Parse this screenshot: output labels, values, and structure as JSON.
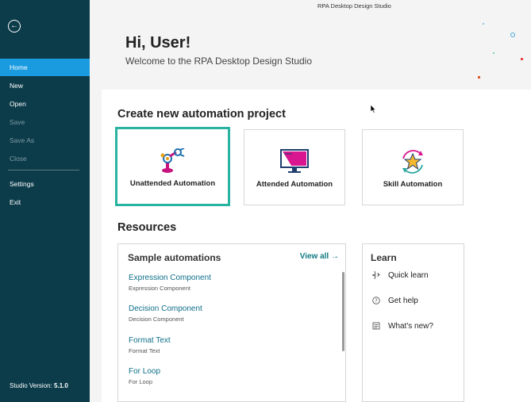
{
  "window": {
    "title": "RPA Desktop Design Studio"
  },
  "sidebar": {
    "items": [
      {
        "label": "Home",
        "state": "active"
      },
      {
        "label": "New",
        "state": "normal"
      },
      {
        "label": "Open",
        "state": "normal"
      },
      {
        "label": "Save",
        "state": "disabled"
      },
      {
        "label": "Save As",
        "state": "disabled"
      },
      {
        "label": "Close",
        "state": "disabled"
      },
      {
        "label": "Settings",
        "state": "normal"
      },
      {
        "label": "Exit",
        "state": "normal"
      }
    ],
    "version_label": "Studio Version:",
    "version_value": "5.1.0"
  },
  "header": {
    "greeting": "Hi, User!",
    "welcome": "Welcome to the RPA Desktop Design Studio"
  },
  "create": {
    "title": "Create new automation project",
    "cards": [
      {
        "label": "Unattended Automation",
        "icon": "robot-arm-icon",
        "selected": true
      },
      {
        "label": "Attended Automation",
        "icon": "monitor-icon",
        "selected": false
      },
      {
        "label": "Skill Automation",
        "icon": "star-cycle-icon",
        "selected": false
      }
    ]
  },
  "resources": {
    "title": "Resources",
    "samples": {
      "title": "Sample automations",
      "view_all": "View all →",
      "items": [
        {
          "title": "Expression Component",
          "subtitle": "Expression Component"
        },
        {
          "title": "Decision Component",
          "subtitle": "Decision Component"
        },
        {
          "title": "Format Text",
          "subtitle": "Format Text"
        },
        {
          "title": "For Loop",
          "subtitle": "For Loop"
        }
      ]
    },
    "learn": {
      "title": "Learn",
      "items": [
        {
          "label": "Quick learn",
          "icon": "sparkle-icon"
        },
        {
          "label": "Get help",
          "icon": "question-icon"
        },
        {
          "label": "What's new?",
          "icon": "news-icon"
        }
      ]
    }
  },
  "colors": {
    "sidebar_bg": "#0c3c4a",
    "nav_active": "#1a9be0",
    "selected_border": "#28b3a0",
    "link": "#0f6f8a"
  }
}
